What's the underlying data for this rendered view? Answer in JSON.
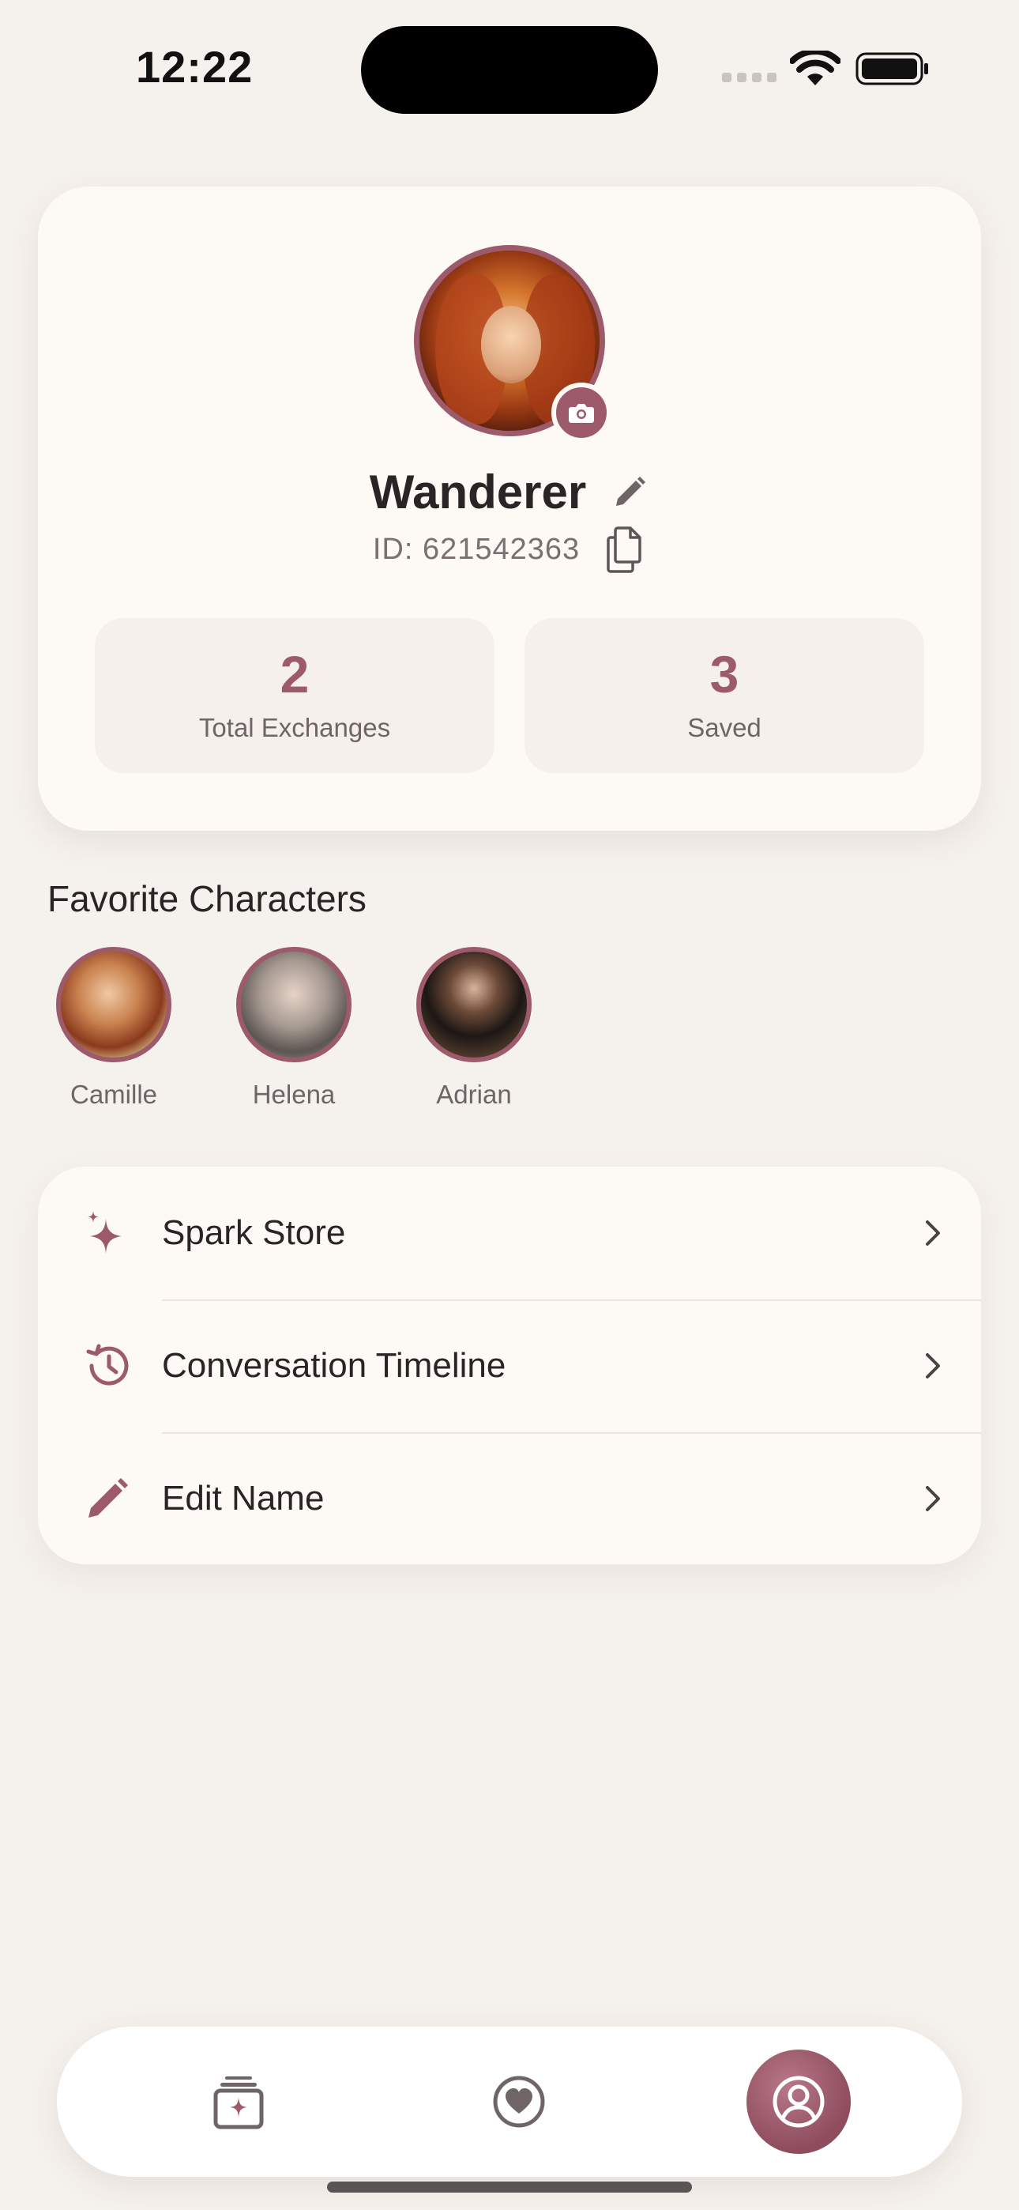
{
  "status_bar": {
    "time": "12:22"
  },
  "profile": {
    "username": "Wanderer",
    "user_id": "ID: 621542363",
    "stats": [
      {
        "value": "2",
        "label": "Total Exchanges"
      },
      {
        "value": "3",
        "label": "Saved"
      }
    ]
  },
  "favorites": {
    "title": "Favorite Characters",
    "items": [
      {
        "name": "Camille"
      },
      {
        "name": "Helena"
      },
      {
        "name": "Adrian"
      }
    ]
  },
  "menu": {
    "items": [
      {
        "label": "Spark Store",
        "icon": "sparkle-icon"
      },
      {
        "label": "Conversation Timeline",
        "icon": "history-icon"
      },
      {
        "label": "Edit Name",
        "icon": "pencil-icon"
      }
    ]
  },
  "tab_bar": {
    "tabs": [
      {
        "icon": "cards-sparkle-icon",
        "active": false
      },
      {
        "icon": "heart-circle-icon",
        "active": false
      },
      {
        "icon": "profile-icon",
        "active": true
      }
    ]
  },
  "colors": {
    "accent": "#9c5a6b",
    "background": "#f5f1ec",
    "card": "#fdf9f5"
  }
}
